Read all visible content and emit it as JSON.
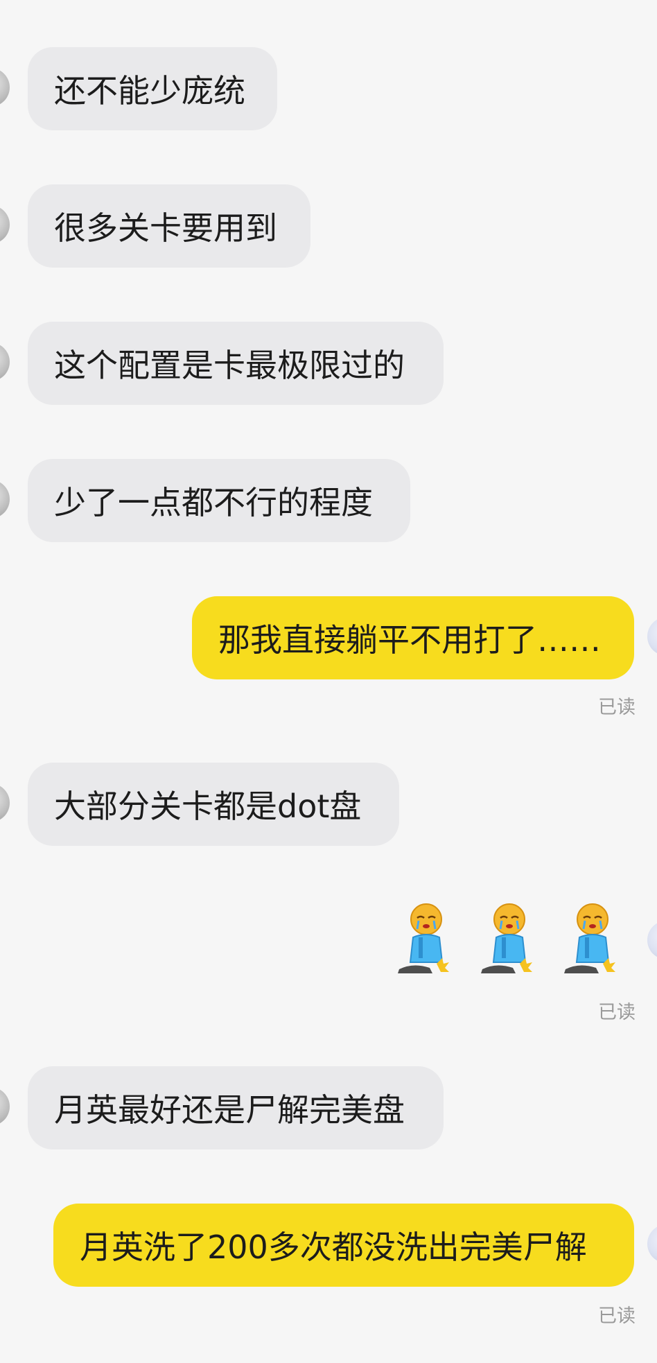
{
  "chat": {
    "messages": [
      {
        "side": "in",
        "text": "还不能少庞统"
      },
      {
        "side": "in",
        "text": "很多关卡要用到"
      },
      {
        "side": "in",
        "text": "这个配置是卡最极限过的"
      },
      {
        "side": "in",
        "text": "少了一点都不行的程度"
      },
      {
        "side": "out",
        "text": "那我直接躺平不用打了……",
        "status": "已读"
      },
      {
        "side": "in",
        "text": "大部分关卡都是dot盘"
      },
      {
        "side": "out",
        "stickers": [
          "crying-kneel-sticker",
          "crying-kneel-sticker",
          "crying-kneel-sticker"
        ],
        "status": "已读"
      },
      {
        "side": "in",
        "text": "月英最好还是尸解完美盘"
      },
      {
        "side": "out",
        "text": "月英洗了200多次都没洗出完美尸解",
        "status": "已读"
      }
    ]
  },
  "colors": {
    "background": "#f6f6f6",
    "incoming_bubble": "#e9e9eb",
    "outgoing_bubble": "#f7dc1e",
    "read_status": "#9a9a9a"
  }
}
